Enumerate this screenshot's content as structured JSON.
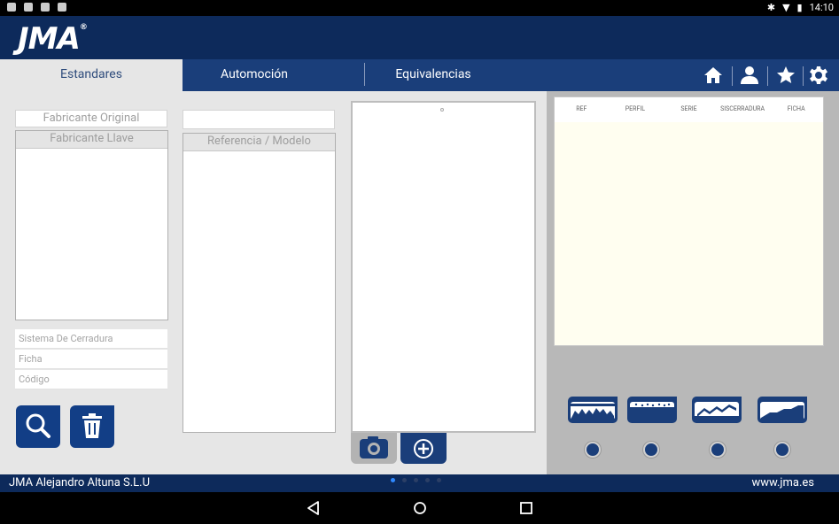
{
  "statusbar": {
    "time": "14:10"
  },
  "header": {
    "logo": "JMA",
    "logo_mark": "®"
  },
  "tabs": [
    {
      "label": "Estandares",
      "active": true
    },
    {
      "label": "Automoción",
      "active": false
    },
    {
      "label": "Equivalencias",
      "active": false
    }
  ],
  "topicons": [
    "home-icon",
    "user-icon",
    "star-icon",
    "gear-icon"
  ],
  "left": {
    "fabricante_original_placeholder": "Fabricante Original",
    "fabricante_llave": "Fabricante Llave",
    "sistema_cerradura": "Sistema De Cerradura",
    "ficha": "Ficha",
    "codigo": "Código"
  },
  "middle": {
    "referencia_modelo": "Referencia / Modelo"
  },
  "table": {
    "columns": [
      "REF",
      "PERFIL",
      "SERIE",
      "SISCERRADURA",
      "FICHA"
    ]
  },
  "footer": {
    "company": "JMA Alejandro Altuna S.L.U",
    "site": "www.jma.es"
  },
  "colors": {
    "brand": "#0d2a5b",
    "tabbar": "#1a3e7a",
    "accent": "#123e86"
  }
}
